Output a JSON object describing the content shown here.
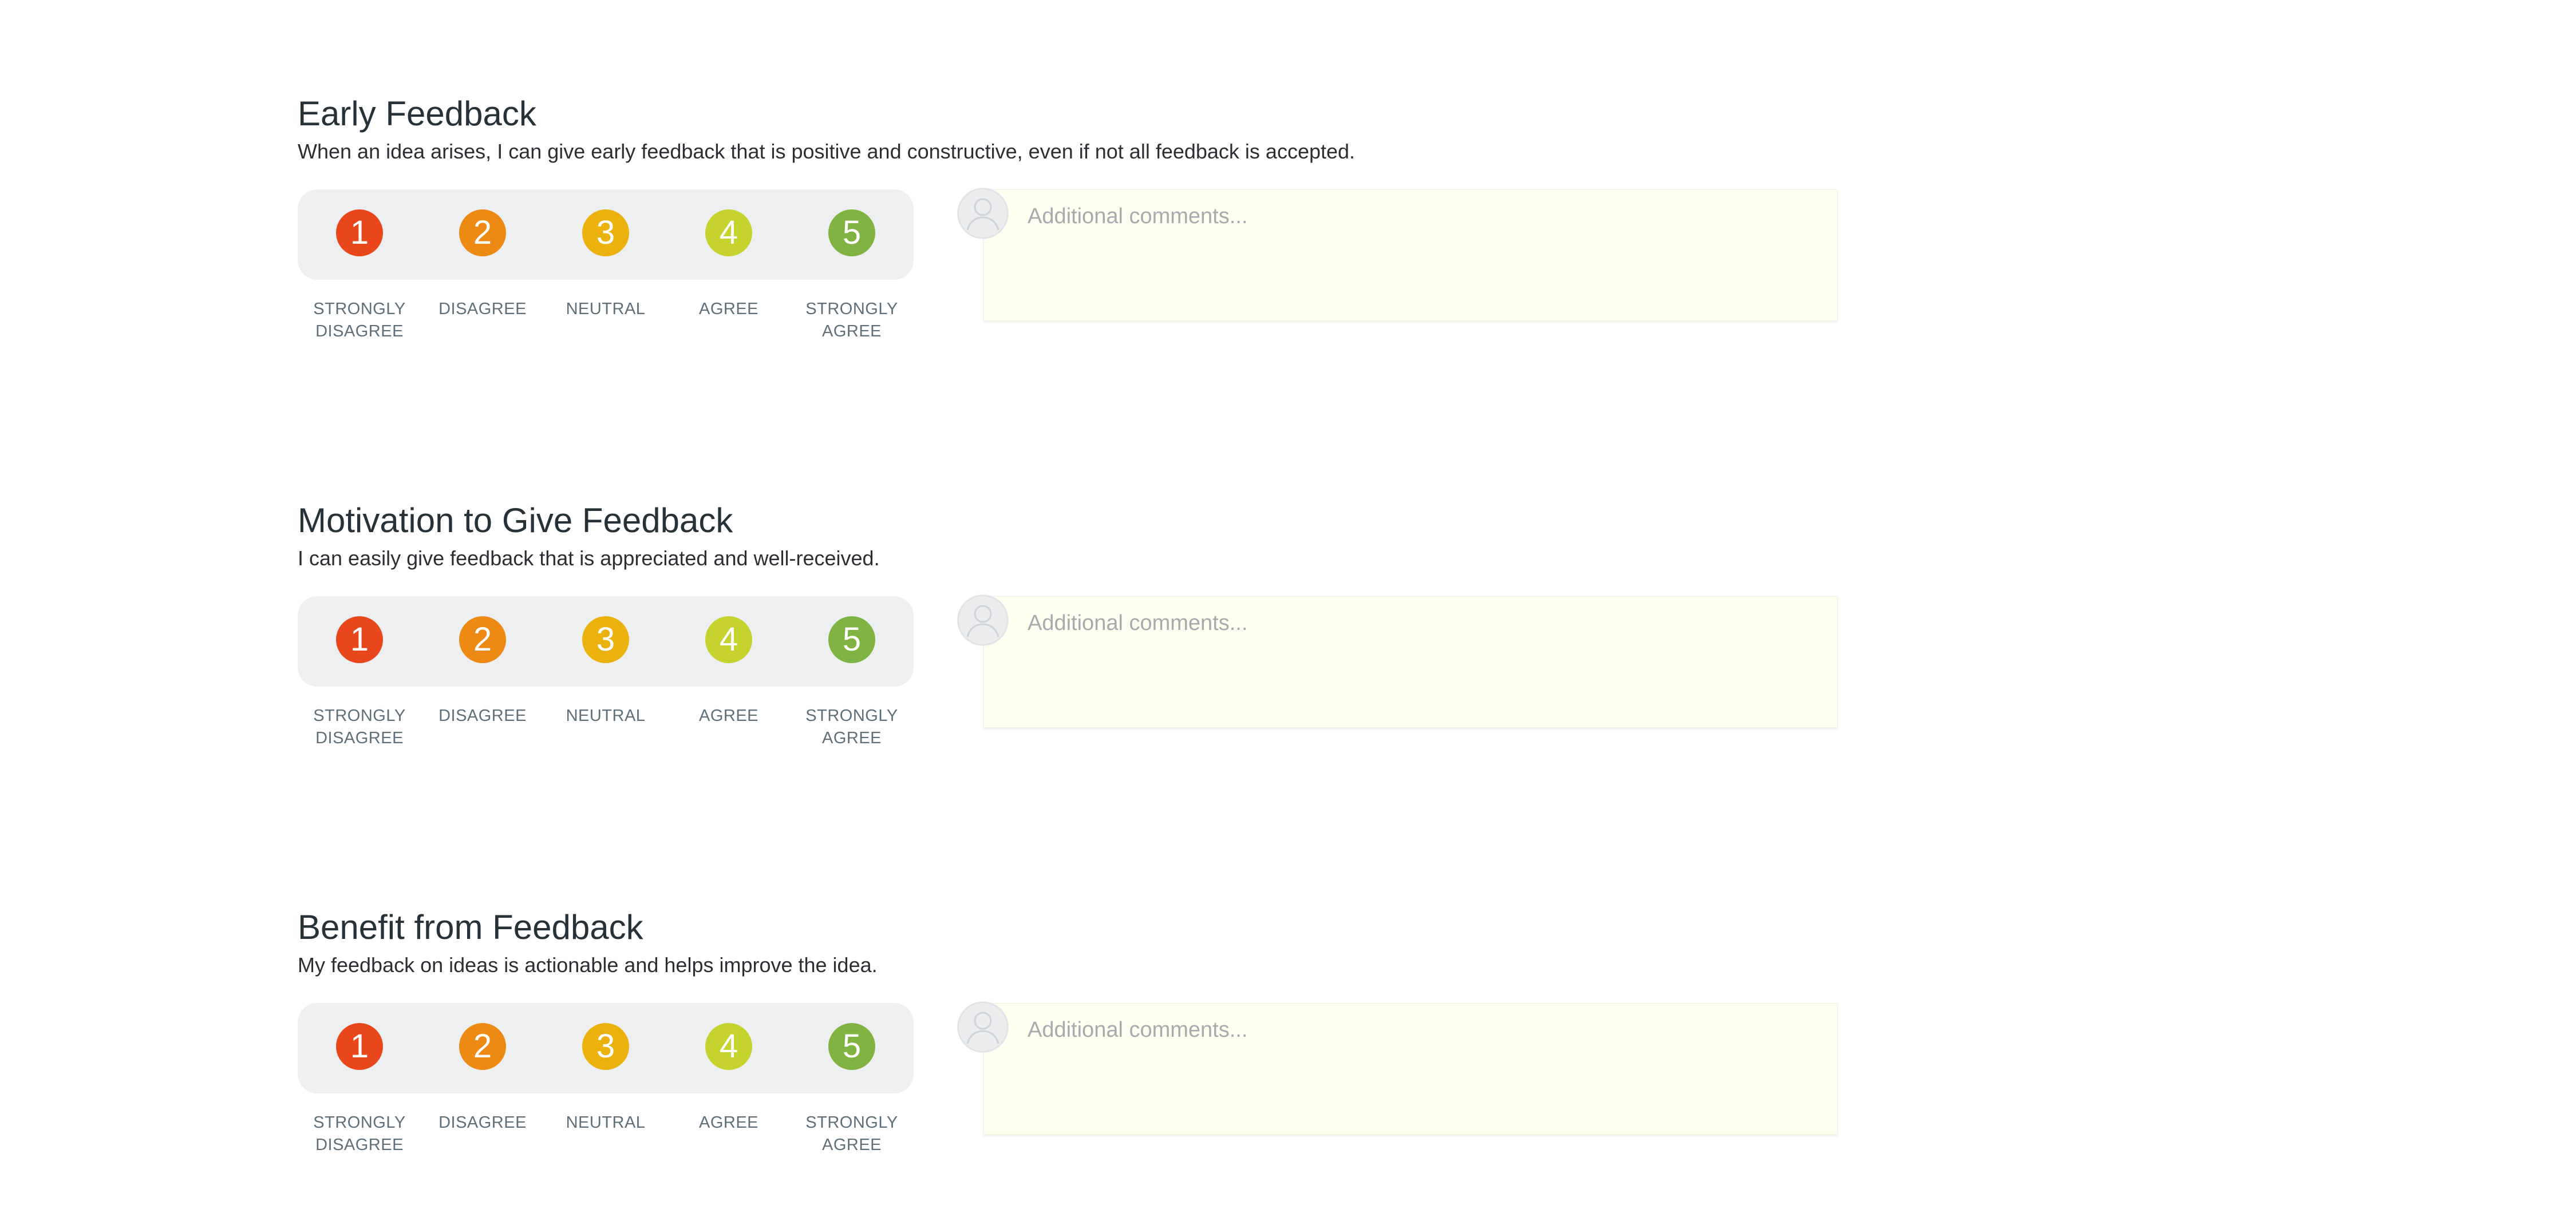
{
  "rating_options": [
    {
      "value": "1",
      "label": "Strongly Disagree",
      "color": "#e9461c"
    },
    {
      "value": "2",
      "label": "Disagree",
      "color": "#ec8a13"
    },
    {
      "value": "3",
      "label": "Neutral",
      "color": "#ebb10d"
    },
    {
      "value": "4",
      "label": "Agree",
      "color": "#c6d22d"
    },
    {
      "value": "5",
      "label": "Strongly Agree",
      "color": "#80b341"
    }
  ],
  "sections": [
    {
      "title": "Early Feedback",
      "description": "When an idea arises, I can give early feedback that is positive and constructive, even if not all feedback is accepted.",
      "comment_placeholder": "Additional comments..."
    },
    {
      "title": "Motivation to Give Feedback",
      "description": "I can easily give feedback that is appreciated and well-received.",
      "comment_placeholder": "Additional comments..."
    },
    {
      "title": "Benefit from Feedback",
      "description": "My feedback on ideas is actionable and helps improve the idea.",
      "comment_placeholder": "Additional comments..."
    }
  ],
  "icons": {
    "avatar": "user-silhouette-icon"
  },
  "colors": {
    "rating_bar_bg": "#eeeff1",
    "comment_bg": "#fffff0",
    "label_color": "#5e6f79"
  }
}
